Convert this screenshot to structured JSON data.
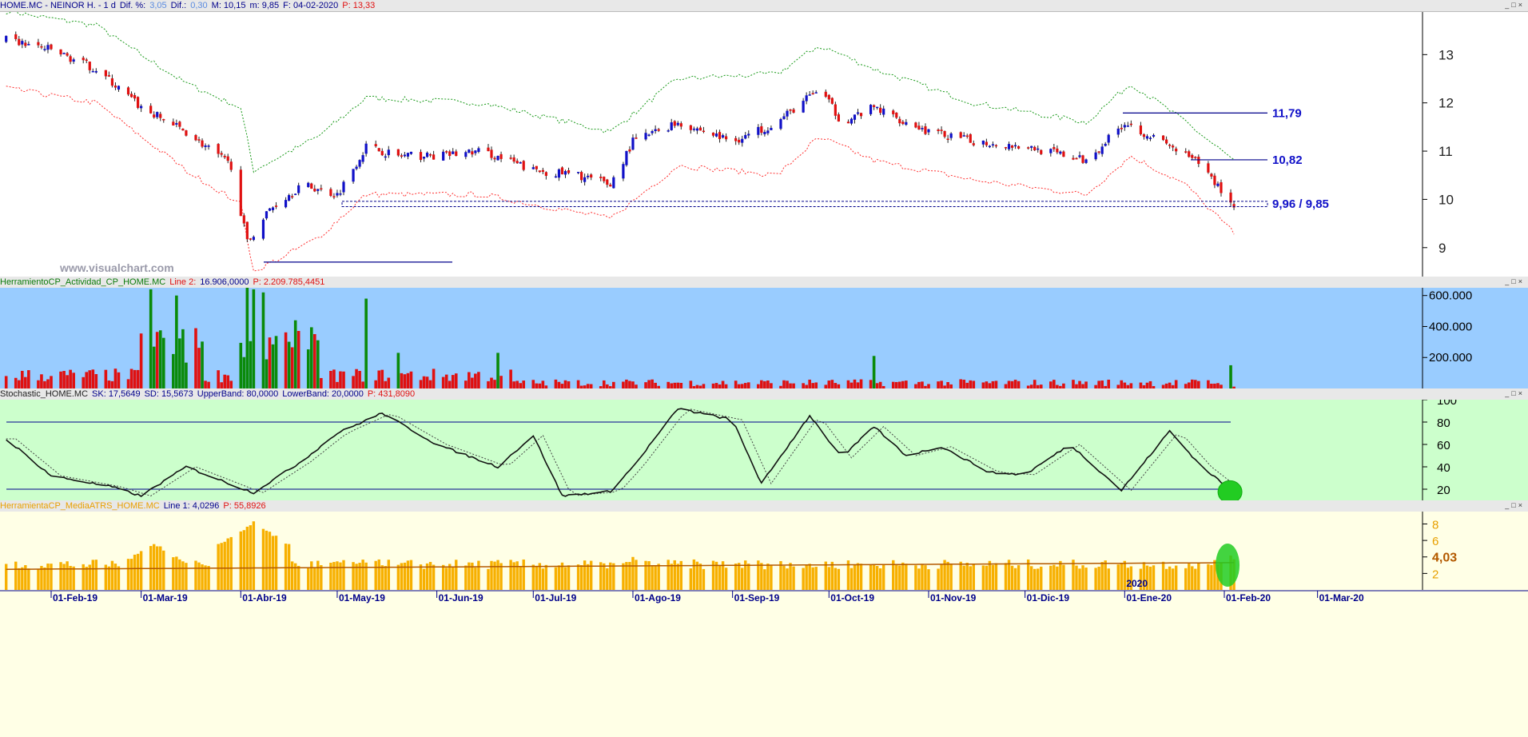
{
  "colors": {
    "up": "#1010c8",
    "down": "#e01010",
    "green": "#0a8a0a",
    "navy": "#00008b",
    "orange": "#f7a800",
    "brown": "#b35900"
  },
  "window_controls": [
    "_",
    "□",
    "×"
  ],
  "price_pane": {
    "header": [
      {
        "text": "HOME.MC - NEINOR H. -  1 d",
        "color": "#00008b"
      },
      {
        "text": "Dif. %:",
        "color": "#00008b"
      },
      {
        "text": "3,05",
        "color": "#5a8be0"
      },
      {
        "text": "Dif.:",
        "color": "#00008b"
      },
      {
        "text": "0,30",
        "color": "#5a8be0"
      },
      {
        "text": "M: 10,15",
        "color": "#00008b"
      },
      {
        "text": "m: 9,85",
        "color": "#00008b"
      },
      {
        "text": "F: 04-02-2020",
        "color": "#00008b"
      },
      {
        "text": "P: 13,33",
        "color": "#e01010"
      }
    ],
    "watermark": "www.visualchart.com",
    "level_labels": {
      "resistance_high": "11,79",
      "resistance_mid": "10,82",
      "support_band": "9,96 / 9,85"
    },
    "y_ticks": [
      "13",
      "12",
      "11",
      "10",
      "9"
    ]
  },
  "volume_pane": {
    "header": [
      {
        "text": "HerramientoCP_Actividad_CP_HOME.MC",
        "color": "#0a7a0a"
      },
      {
        "text": "Line 2:",
        "color": "#e01010"
      },
      {
        "text": "16.906,0000",
        "color": "#00008b"
      },
      {
        "text": "P: 2.209.785,4451",
        "color": "#e01010"
      }
    ],
    "y_ticks": [
      "600.000",
      "400.000",
      "200.000"
    ]
  },
  "stoch_pane": {
    "header": [
      {
        "text": "Stochastic_HOME.MC",
        "color": "#222"
      },
      {
        "text": "SK: 17,5649",
        "color": "#00008b"
      },
      {
        "text": "SD: 15,5673",
        "color": "#00008b"
      },
      {
        "text": "UpperBand: 80,0000",
        "color": "#00008b"
      },
      {
        "text": "LowerBand: 20,0000",
        "color": "#00008b"
      },
      {
        "text": "P: 431,8090",
        "color": "#e01010"
      }
    ],
    "y_ticks": [
      "100",
      "80",
      "60",
      "40",
      "20"
    ]
  },
  "atr_pane": {
    "header": [
      {
        "text": "HerramientaCP_MediaATRS_HOME.MC",
        "color": "#e8a000"
      },
      {
        "text": "Line 1: 4,0296",
        "color": "#00008b"
      },
      {
        "text": "P: 55,8926",
        "color": "#e01010"
      }
    ],
    "y_ticks": [
      "8",
      "6",
      "4",
      "2"
    ],
    "last_value_label": "4,03",
    "year_marker": "2020"
  },
  "x_axis_labels": [
    "01-Feb-19",
    "01-Mar-19",
    "01-Abr-19",
    "01-May-19",
    "01-Jun-19",
    "01-Jul-19",
    "01-Ago-19",
    "01-Sep-19",
    "01-Oct-19",
    "01-Nov-19",
    "01-Dic-19",
    "01-Ene-20",
    "01-Feb-20",
    "01-Mar-20"
  ],
  "chart_data": [
    {
      "type": "candlestick",
      "name": "HOME.MC price",
      "x_range": [
        "2019-01-18",
        "2020-03-10"
      ],
      "ylim": [
        8.4,
        13.9
      ],
      "levels": [
        {
          "value": 11.79,
          "label": "11,79"
        },
        {
          "value": 10.82,
          "label": "10,82"
        },
        {
          "value": 9.96,
          "label": "9,96"
        },
        {
          "value": 9.85,
          "label": "9,85"
        },
        {
          "value": 8.7
        }
      ],
      "close_path": [
        [
          "2019-01-18",
          13.3
        ],
        [
          "2019-02-01",
          13.1
        ],
        [
          "2019-02-15",
          12.7
        ],
        [
          "2019-03-01",
          11.9
        ],
        [
          "2019-03-15",
          11.4
        ],
        [
          "2019-03-29",
          10.7
        ],
        [
          "2019-04-03",
          9.1
        ],
        [
          "2019-04-10",
          9.8
        ],
        [
          "2019-04-20",
          10.3
        ],
        [
          "2019-05-01",
          10.1
        ],
        [
          "2019-05-10",
          11.1
        ],
        [
          "2019-05-20",
          10.9
        ],
        [
          "2019-06-01",
          10.9
        ],
        [
          "2019-06-15",
          11.0
        ],
        [
          "2019-07-01",
          10.6
        ],
        [
          "2019-07-15",
          10.5
        ],
        [
          "2019-07-25",
          10.3
        ],
        [
          "2019-08-01",
          11.2
        ],
        [
          "2019-08-15",
          11.6
        ],
        [
          "2019-09-01",
          11.2
        ],
        [
          "2019-09-15",
          11.6
        ],
        [
          "2019-09-28",
          12.3
        ],
        [
          "2019-10-05",
          11.6
        ],
        [
          "2019-10-15",
          11.9
        ],
        [
          "2019-11-01",
          11.4
        ],
        [
          "2019-11-15",
          11.2
        ],
        [
          "2019-12-01",
          11.1
        ],
        [
          "2019-12-20",
          10.8
        ],
        [
          "2020-01-01",
          11.6
        ],
        [
          "2020-01-15",
          11.1
        ],
        [
          "2020-01-25",
          10.7
        ],
        [
          "2020-02-04",
          9.85
        ]
      ],
      "upper_band_path": [
        [
          "2019-01-18",
          13.9
        ],
        [
          "2019-02-15",
          13.6
        ],
        [
          "2019-03-15",
          12.4
        ],
        [
          "2019-04-01",
          11.9
        ],
        [
          "2019-04-05",
          10.6
        ],
        [
          "2019-04-25",
          11.3
        ],
        [
          "2019-05-10",
          12.1
        ],
        [
          "2019-06-15",
          12.0
        ],
        [
          "2019-07-25",
          11.4
        ],
        [
          "2019-08-15",
          12.5
        ],
        [
          "2019-09-15",
          12.6
        ],
        [
          "2019-09-28",
          13.2
        ],
        [
          "2019-10-15",
          12.7
        ],
        [
          "2019-11-15",
          12.0
        ],
        [
          "2019-12-20",
          11.6
        ],
        [
          "2020-01-03",
          12.4
        ],
        [
          "2020-01-20",
          11.6
        ],
        [
          "2020-02-04",
          10.8
        ]
      ],
      "lower_band_path": [
        [
          "2019-01-18",
          12.3
        ],
        [
          "2019-02-15",
          12.0
        ],
        [
          "2019-03-15",
          10.6
        ],
        [
          "2019-04-01",
          9.9
        ],
        [
          "2019-04-05",
          8.5
        ],
        [
          "2019-04-25",
          9.2
        ],
        [
          "2019-05-10",
          10.1
        ],
        [
          "2019-06-15",
          10.1
        ],
        [
          "2019-07-25",
          9.6
        ],
        [
          "2019-08-15",
          10.7
        ],
        [
          "2019-09-15",
          10.5
        ],
        [
          "2019-09-28",
          11.3
        ],
        [
          "2019-10-15",
          10.8
        ],
        [
          "2019-11-15",
          10.4
        ],
        [
          "2019-12-20",
          10.1
        ],
        [
          "2020-01-03",
          10.9
        ],
        [
          "2020-01-20",
          10.3
        ],
        [
          "2020-02-04",
          9.3
        ]
      ]
    },
    {
      "type": "bar",
      "name": "Actividad volume",
      "ylim": [
        0,
        650000
      ],
      "spikes": [
        [
          "2019-03-04",
          640000
        ],
        [
          "2019-03-12",
          600000
        ],
        [
          "2019-04-03",
          650000
        ],
        [
          "2019-04-05",
          640000
        ],
        [
          "2019-04-08",
          620000
        ],
        [
          "2019-04-18",
          440000
        ],
        [
          "2019-05-10",
          580000
        ],
        [
          "2019-05-20",
          230000
        ],
        [
          "2019-06-20",
          230000
        ],
        [
          "2019-09-07",
          250000
        ],
        [
          "2019-10-15",
          210000
        ],
        [
          "2020-02-03",
          150000
        ]
      ],
      "typical_range": [
        20000,
        120000
      ]
    },
    {
      "type": "line",
      "name": "Stochastic",
      "ylim": [
        10,
        100
      ],
      "bands": [
        80,
        20
      ],
      "sk_path": [
        [
          "2019-01-18",
          65
        ],
        [
          "2019-02-01",
          32
        ],
        [
          "2019-02-20",
          22
        ],
        [
          "2019-03-01",
          14
        ],
        [
          "2019-03-15",
          40
        ],
        [
          "2019-04-01",
          21
        ],
        [
          "2019-04-05",
          17
        ],
        [
          "2019-04-20",
          45
        ],
        [
          "2019-05-01",
          70
        ],
        [
          "2019-05-15",
          88
        ],
        [
          "2019-06-01",
          60
        ],
        [
          "2019-06-20",
          40
        ],
        [
          "2019-07-01",
          68
        ],
        [
          "2019-07-10",
          14
        ],
        [
          "2019-07-25",
          18
        ],
        [
          "2019-08-01",
          40
        ],
        [
          "2019-08-15",
          92
        ],
        [
          "2019-09-01",
          82
        ],
        [
          "2019-09-10",
          25
        ],
        [
          "2019-09-25",
          86
        ],
        [
          "2019-10-05",
          48
        ],
        [
          "2019-10-15",
          76
        ],
        [
          "2019-10-25",
          50
        ],
        [
          "2019-11-05",
          58
        ],
        [
          "2019-11-20",
          35
        ],
        [
          "2019-12-01",
          33
        ],
        [
          "2019-12-15",
          60
        ],
        [
          "2019-12-31",
          19
        ],
        [
          "2020-01-15",
          72
        ],
        [
          "2020-01-25",
          40
        ],
        [
          "2020-02-04",
          17.56
        ]
      ],
      "sd_last": 15.57
    },
    {
      "type": "bar",
      "name": "MediaATRS",
      "ylim": [
        0,
        9.5
      ],
      "last_value": 4.03,
      "spikes": [
        [
          "2019-03-05",
          5.8
        ],
        [
          "2019-04-05",
          8.4
        ],
        [
          "2019-05-15",
          3.2
        ],
        [
          "2019-08-01",
          4.0
        ],
        [
          "2019-09-15",
          3.4
        ],
        [
          "2020-02-03",
          4.2
        ]
      ],
      "avg_level": 2.9
    }
  ]
}
